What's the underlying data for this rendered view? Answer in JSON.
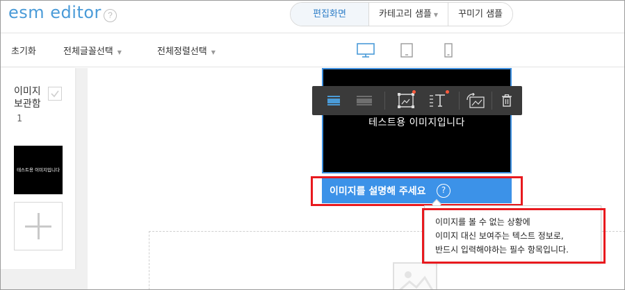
{
  "app": {
    "logo": "esm editor",
    "help": "?"
  },
  "tabs": [
    {
      "label": "편집화면",
      "active": true
    },
    {
      "label": "카테고리 샘플",
      "caret": "▼"
    },
    {
      "label": "꾸미기 샘플"
    }
  ],
  "toolbar": {
    "reset": "초기화",
    "font_select": "전체글꼴선택",
    "align_select": "전체정렬선택",
    "caret": "▼",
    "devices": [
      "desktop-icon",
      "tablet-icon",
      "mobile-icon"
    ]
  },
  "side": {
    "title": "이미지 보관함",
    "count": "1",
    "thumb_text": "테스트용 이미지입니다"
  },
  "editor": {
    "image_text": "테스트용 이미지입니다",
    "caption": "이미지를 설명해 주세요",
    "caption_help": "?",
    "tooltip": [
      "이미지를 볼 수 없는 상황에",
      "이미지 대신 보여주는 텍스트 정보로,",
      "반드시 입력해야하는 필수 항목입니다."
    ]
  },
  "colors": {
    "accent": "#4a9bd8",
    "highlight": "#e8191e",
    "caption_bg": "#3c92e8"
  }
}
